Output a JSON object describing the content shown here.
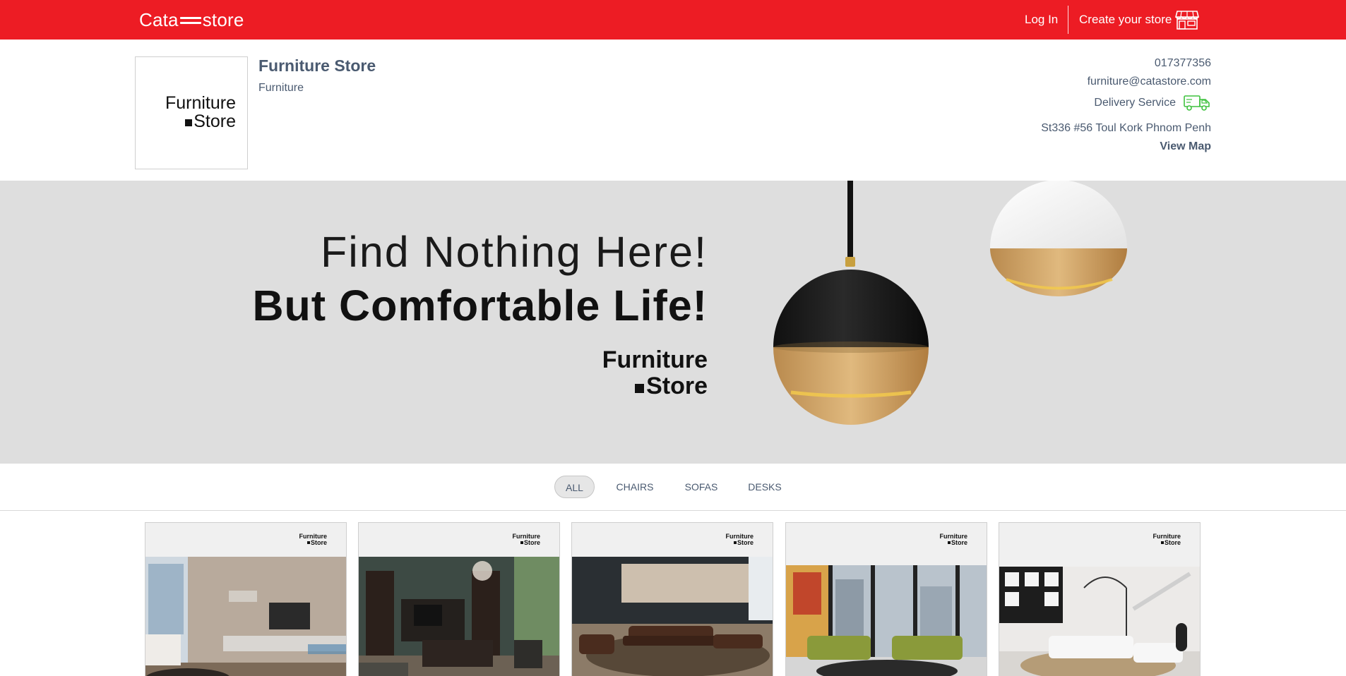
{
  "navbar": {
    "brand_left": "Cata",
    "brand_right": "store",
    "login_label": "Log In",
    "create_store_label": "Create your store",
    "store_icon": "storefront-icon",
    "background": "#ed1c24"
  },
  "store": {
    "logo_line1": "Furniture",
    "logo_line2": "Store",
    "name": "Furniture Store",
    "category": "Furniture",
    "phone": "017377356",
    "email": "furniture@catastore.com",
    "delivery_label": "Delivery Service",
    "delivery_icon": "delivery-truck-icon",
    "address": "St336 #56 Toul Kork Phnom Penh",
    "view_map_label": "View Map"
  },
  "banner": {
    "line1": "Find Nothing Here!",
    "line2": "But Comfortable Life!",
    "brand_line1": "Furniture",
    "brand_line2": "Store",
    "background": "#dedede"
  },
  "tabs": [
    {
      "label": "ALL",
      "active": true
    },
    {
      "label": "CHAIRS",
      "active": false
    },
    {
      "label": "SOFAS",
      "active": false
    },
    {
      "label": "DESKS",
      "active": false
    }
  ],
  "products": [
    {
      "logo_line1": "Furniture",
      "logo_line2": "Store",
      "scene": "living-room-tv-wall"
    },
    {
      "logo_line1": "Furniture",
      "logo_line2": "Store",
      "scene": "dark-living-room-chandelier"
    },
    {
      "logo_line1": "Furniture",
      "logo_line2": "Store",
      "scene": "brown-leather-sofa-set"
    },
    {
      "logo_line1": "Furniture",
      "logo_line2": "Store",
      "scene": "green-sofa-city-view"
    },
    {
      "logo_line1": "Furniture",
      "logo_line2": "Store",
      "scene": "white-sofa-floor-lamp"
    }
  ]
}
